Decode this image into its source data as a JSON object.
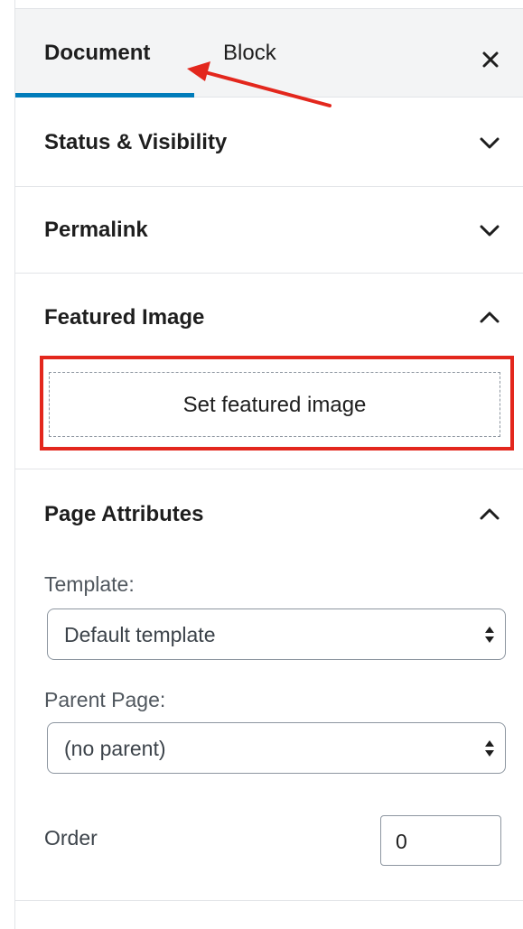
{
  "tabs": [
    {
      "label": "Document",
      "active": true
    },
    {
      "label": "Block",
      "active": false
    }
  ],
  "close_icon": "close-icon",
  "sections": {
    "status": {
      "title": "Status & Visibility",
      "expanded": false
    },
    "permalink": {
      "title": "Permalink",
      "expanded": false
    },
    "featured": {
      "title": "Featured Image",
      "expanded": true,
      "button_label": "Set featured image"
    },
    "attributes": {
      "title": "Page Attributes",
      "expanded": true,
      "template_label": "Template:",
      "template_value": "Default template",
      "parent_label": "Parent Page:",
      "parent_value": "(no parent)",
      "order_label": "Order",
      "order_value": "0"
    }
  },
  "colors": {
    "accent": "#007cba",
    "annotation": "#e3271d",
    "tab_bar_bg": "#f3f4f5"
  }
}
